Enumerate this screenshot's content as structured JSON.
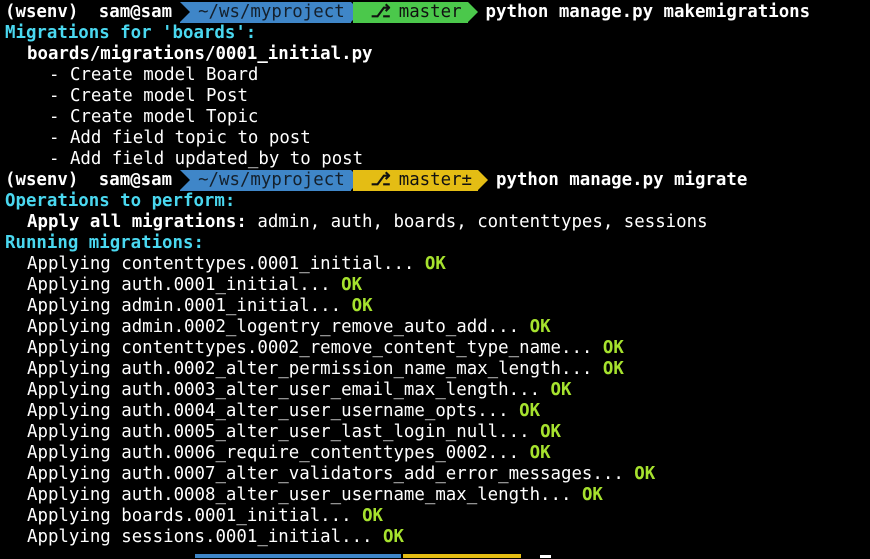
{
  "prompt1": {
    "env": "(wsenv)",
    "user": "sam@sam",
    "dir": "~/ws/myproject",
    "git_icon": "ᴘ",
    "branch": "master",
    "command": "python manage.py makemigrations"
  },
  "makemigrations": {
    "header": "Migrations for 'boards':",
    "file": "boards/migrations/0001_initial.py",
    "steps": [
      "- Create model Board",
      "- Create model Post",
      "- Create model Topic",
      "- Add field topic to post",
      "- Add field updated_by to post"
    ]
  },
  "prompt2": {
    "env": "(wsenv)",
    "user": "sam@sam",
    "dir": "~/ws/myproject",
    "branch": "master±",
    "command": "python manage.py migrate"
  },
  "migrate": {
    "ops_header": "Operations to perform:",
    "apply_label": "Apply all migrations:",
    "apply_apps": " admin, auth, boards, contenttypes, sessions",
    "running_header": "Running migrations:",
    "applying_prefix": "Applying ",
    "ok": "OK",
    "migrations": [
      "contenttypes.0001_initial...",
      "auth.0001_initial...",
      "admin.0001_initial...",
      "admin.0002_logentry_remove_auto_add...",
      "contenttypes.0002_remove_content_type_name...",
      "auth.0002_alter_permission_name_max_length...",
      "auth.0003_alter_user_email_max_length...",
      "auth.0004_alter_user_username_opts...",
      "auth.0005_alter_user_last_login_null...",
      "auth.0006_require_contenttypes_0002...",
      "auth.0007_alter_validators_add_error_messages...",
      "auth.0008_alter_user_username_max_length...",
      "boards.0001_initial...",
      "sessions.0001_initial..."
    ]
  },
  "colors": {
    "background": "#000000",
    "cyan_header": "#4ad8f0",
    "ok_green": "#a6e22e",
    "dir_segment": "#3f86c8",
    "git_clean": "#4bc84b",
    "git_dirty": "#e4bd14"
  }
}
